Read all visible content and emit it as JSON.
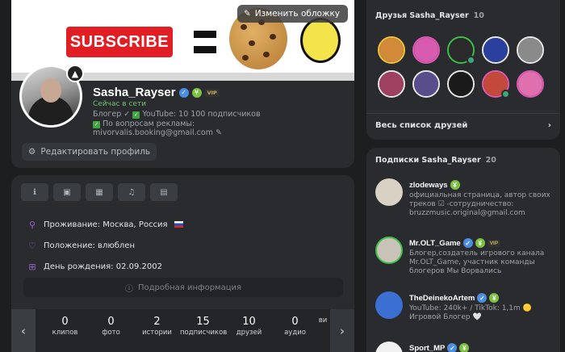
{
  "profile": {
    "cover_button": "Изменить обложку",
    "cover_text": "SUBSCRIBE",
    "name": "Sasha_Rayser",
    "vip_label": "VIP",
    "online_status": "Сейчас в сети",
    "status_line1": "Блогер ✓",
    "status_line1b": "YouTube: 10 100 подписчиков",
    "status_line2": "По вопросам рекламы:",
    "status_line3": "mivorvalis.booking@gmail.com",
    "edit_button": "Редактировать профиль"
  },
  "info": {
    "rows": [
      {
        "label": "Проживание: Москва, Россия",
        "icon": "location-pin-icon"
      },
      {
        "label": "Положение: влюблен",
        "icon": "heart-icon"
      },
      {
        "label": "День рождения: 02.09.2002",
        "icon": "gift-icon"
      }
    ],
    "detail_button": "Подробная информация"
  },
  "counters": [
    {
      "num": "0",
      "label": "клипов"
    },
    {
      "num": "0",
      "label": "фото"
    },
    {
      "num": "2",
      "label": "истории"
    },
    {
      "num": "15",
      "label": "подписчиков"
    },
    {
      "num": "10",
      "label": "друзей"
    },
    {
      "num": "0",
      "label": "аудио"
    },
    {
      "num": "",
      "label": "ви"
    }
  ],
  "friends": {
    "title": "Друзья Sasha_Rayser",
    "count": "10",
    "all_link": "Весь список друзей",
    "avatar_colors": [
      "#d18a3a",
      "#d85bb0",
      "#2a2a2a",
      "#2b3f9e",
      "#8a8a8a",
      "#a04060",
      "#5a4d8c",
      "#1a1a1a",
      "#c34a3a",
      "#e06fb0"
    ],
    "ring_colors": [
      "#f2c23a",
      "#d85bb0",
      "#3fbf4a",
      "#e7e7e7",
      "#e7e7e7",
      "#e7e7e7",
      "#e7e7e7",
      "#e7e7e7",
      "#d85bb0",
      "#d85bb0"
    ]
  },
  "subscriptions": {
    "title": "Подписки Sasha_Rayser",
    "count": "20",
    "items": [
      {
        "name": "zlodeways",
        "desc": "официальная страница, автор своих треков ☑ -сотрудничество: bruzzmusic.original@gmail.com",
        "color": "#d9d2c4"
      },
      {
        "name": "Mr.OLT_Game",
        "desc": "Блогер,создатель игрового канала Mr.OLT_Game, участник команды блогеров Мы Ворвались",
        "color": "#c9c2b8"
      },
      {
        "name": "TheDeinekoArtem",
        "desc": "YouTube: 240k+ / TikTok: 1,1m 🟡 Игровой Блогер 🤍",
        "color": "#3b6fd1"
      },
      {
        "name": "Sport_MP",
        "desc": "",
        "color": "#f0f0f0"
      }
    ]
  }
}
